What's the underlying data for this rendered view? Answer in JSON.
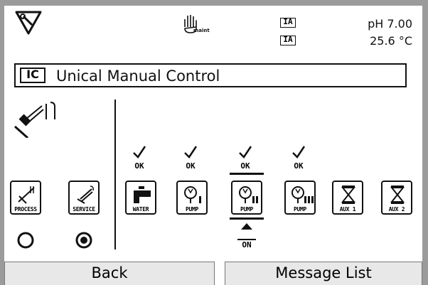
{
  "status": {
    "maint_label": "maint",
    "ia_top": "IA",
    "ia_bottom": "IA",
    "ph": "pH 7.00",
    "temp": "25.6 °C"
  },
  "title": {
    "badge": "IC",
    "text": "Unical Manual Control"
  },
  "modes": [
    {
      "label": "PROCESS",
      "selected": false
    },
    {
      "label": "SERVICE",
      "selected": true
    }
  ],
  "outputs": [
    {
      "label": "WATER",
      "status": "OK",
      "icon": "tap-icon"
    },
    {
      "label": "PUMP",
      "status": "OK",
      "icon": "pump-1-icon"
    },
    {
      "label": "PUMP",
      "status": "OK",
      "icon": "pump-2-icon",
      "active": true,
      "active_label": "ON"
    },
    {
      "label": "PUMP",
      "status": "OK",
      "icon": "pump-3-icon"
    },
    {
      "label": "AUX 1",
      "icon": "valve-icon"
    },
    {
      "label": "AUX 2",
      "icon": "valve-icon"
    }
  ],
  "softkeys": {
    "left": "Back",
    "right": "Message List"
  }
}
